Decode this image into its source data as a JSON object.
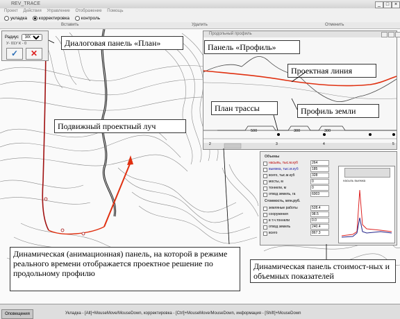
{
  "window": {
    "title": "REV_TRACE",
    "minimize": "_",
    "maximize": "□",
    "close": "×"
  },
  "menu": [
    "Проект",
    "Действия",
    "Управление",
    "Отображение",
    "Помощь"
  ],
  "modes": {
    "m1": "укладка",
    "m2": "корректировка",
    "m3": "контроль",
    "selected": "корректировка"
  },
  "commands": {
    "insert": "Вставить",
    "delete": "Удалить",
    "undo": "Отменить"
  },
  "plan_panel": {
    "radius_label": "Радиус",
    "radius_value": "300",
    "row2": "У- 01У  К - 0",
    "ok": "✓",
    "cancel": "✕"
  },
  "profile_panel": {
    "title": "Продольный профиль",
    "plan_segments": [
      "500",
      "300",
      "300"
    ],
    "stations": [
      "2",
      "3",
      "4",
      "5"
    ]
  },
  "stats_panel": {
    "header1": "Объемы",
    "header2": "Стоимость, млн.руб.",
    "volumes": [
      {
        "label": "насыпь, тыс.м.куб",
        "value": "264"
      },
      {
        "label": "выемка, тыс.м.куб",
        "value": "185"
      },
      {
        "label": "всего, тыс.м.куб",
        "value": "328"
      },
      {
        "label": "мосты, м",
        "value": "0"
      },
      {
        "label": "тоннели, м",
        "value": "0"
      },
      {
        "label": "отвод земель, га",
        "value": "6003"
      }
    ],
    "costs": [
      {
        "label": "земляные работы",
        "value": "528.4"
      },
      {
        "label": "сооружения",
        "value": "98.5"
      },
      {
        "label": "в т.ч.тоннели",
        "value": "0.0"
      },
      {
        "label": "отвод земель",
        "value": "240.4"
      },
      {
        "label": "всего",
        "value": "867.3"
      }
    ],
    "mini_chart_label": "насыпь  выемка"
  },
  "annotations": {
    "plan": "Диалоговая панель «План»",
    "profile": "Панель «Профиль»",
    "design_line": "Проектная линия",
    "route_plan": "План трассы",
    "ground": "Профиль земли",
    "ray": "Подвижный проектный луч",
    "anim": "Динамическая (анимационная) панель, на которой в режиме реального времени отображается проектное решение по продольному профилю",
    "stats": "Динамическая панель стоимост-ных и объемных показателей"
  },
  "status": {
    "start": "Оповещения",
    "message": "Укладка - [Alt]+MouseMove/MouseDown, корректировка - [Ctrl]+MouseMove/MouseDown, информация - [Shift]+MouseDown"
  },
  "colors": {
    "design_line": "#e03010",
    "ground_line": "#444444",
    "route": "#a01010",
    "ray": "#e03010",
    "river": "#222222"
  }
}
